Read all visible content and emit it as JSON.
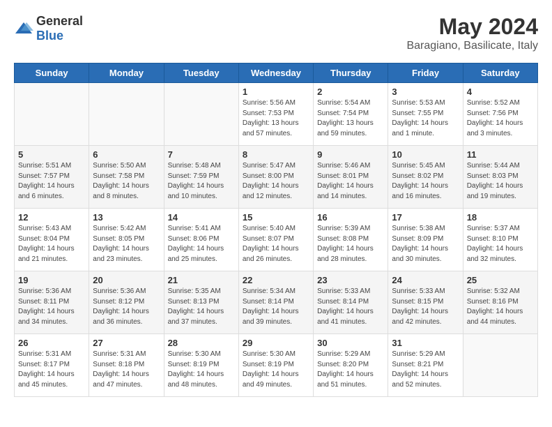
{
  "logo": {
    "general": "General",
    "blue": "Blue"
  },
  "header": {
    "month_year": "May 2024",
    "location": "Baragiano, Basilicate, Italy"
  },
  "weekdays": [
    "Sunday",
    "Monday",
    "Tuesday",
    "Wednesday",
    "Thursday",
    "Friday",
    "Saturday"
  ],
  "weeks": [
    [
      {
        "day": "",
        "sunrise": "",
        "sunset": "",
        "daylight": ""
      },
      {
        "day": "",
        "sunrise": "",
        "sunset": "",
        "daylight": ""
      },
      {
        "day": "",
        "sunrise": "",
        "sunset": "",
        "daylight": ""
      },
      {
        "day": "1",
        "sunrise": "Sunrise: 5:56 AM",
        "sunset": "Sunset: 7:53 PM",
        "daylight": "Daylight: 13 hours and 57 minutes."
      },
      {
        "day": "2",
        "sunrise": "Sunrise: 5:54 AM",
        "sunset": "Sunset: 7:54 PM",
        "daylight": "Daylight: 13 hours and 59 minutes."
      },
      {
        "day": "3",
        "sunrise": "Sunrise: 5:53 AM",
        "sunset": "Sunset: 7:55 PM",
        "daylight": "Daylight: 14 hours and 1 minute."
      },
      {
        "day": "4",
        "sunrise": "Sunrise: 5:52 AM",
        "sunset": "Sunset: 7:56 PM",
        "daylight": "Daylight: 14 hours and 3 minutes."
      }
    ],
    [
      {
        "day": "5",
        "sunrise": "Sunrise: 5:51 AM",
        "sunset": "Sunset: 7:57 PM",
        "daylight": "Daylight: 14 hours and 6 minutes."
      },
      {
        "day": "6",
        "sunrise": "Sunrise: 5:50 AM",
        "sunset": "Sunset: 7:58 PM",
        "daylight": "Daylight: 14 hours and 8 minutes."
      },
      {
        "day": "7",
        "sunrise": "Sunrise: 5:48 AM",
        "sunset": "Sunset: 7:59 PM",
        "daylight": "Daylight: 14 hours and 10 minutes."
      },
      {
        "day": "8",
        "sunrise": "Sunrise: 5:47 AM",
        "sunset": "Sunset: 8:00 PM",
        "daylight": "Daylight: 14 hours and 12 minutes."
      },
      {
        "day": "9",
        "sunrise": "Sunrise: 5:46 AM",
        "sunset": "Sunset: 8:01 PM",
        "daylight": "Daylight: 14 hours and 14 minutes."
      },
      {
        "day": "10",
        "sunrise": "Sunrise: 5:45 AM",
        "sunset": "Sunset: 8:02 PM",
        "daylight": "Daylight: 14 hours and 16 minutes."
      },
      {
        "day": "11",
        "sunrise": "Sunrise: 5:44 AM",
        "sunset": "Sunset: 8:03 PM",
        "daylight": "Daylight: 14 hours and 19 minutes."
      }
    ],
    [
      {
        "day": "12",
        "sunrise": "Sunrise: 5:43 AM",
        "sunset": "Sunset: 8:04 PM",
        "daylight": "Daylight: 14 hours and 21 minutes."
      },
      {
        "day": "13",
        "sunrise": "Sunrise: 5:42 AM",
        "sunset": "Sunset: 8:05 PM",
        "daylight": "Daylight: 14 hours and 23 minutes."
      },
      {
        "day": "14",
        "sunrise": "Sunrise: 5:41 AM",
        "sunset": "Sunset: 8:06 PM",
        "daylight": "Daylight: 14 hours and 25 minutes."
      },
      {
        "day": "15",
        "sunrise": "Sunrise: 5:40 AM",
        "sunset": "Sunset: 8:07 PM",
        "daylight": "Daylight: 14 hours and 26 minutes."
      },
      {
        "day": "16",
        "sunrise": "Sunrise: 5:39 AM",
        "sunset": "Sunset: 8:08 PM",
        "daylight": "Daylight: 14 hours and 28 minutes."
      },
      {
        "day": "17",
        "sunrise": "Sunrise: 5:38 AM",
        "sunset": "Sunset: 8:09 PM",
        "daylight": "Daylight: 14 hours and 30 minutes."
      },
      {
        "day": "18",
        "sunrise": "Sunrise: 5:37 AM",
        "sunset": "Sunset: 8:10 PM",
        "daylight": "Daylight: 14 hours and 32 minutes."
      }
    ],
    [
      {
        "day": "19",
        "sunrise": "Sunrise: 5:36 AM",
        "sunset": "Sunset: 8:11 PM",
        "daylight": "Daylight: 14 hours and 34 minutes."
      },
      {
        "day": "20",
        "sunrise": "Sunrise: 5:36 AM",
        "sunset": "Sunset: 8:12 PM",
        "daylight": "Daylight: 14 hours and 36 minutes."
      },
      {
        "day": "21",
        "sunrise": "Sunrise: 5:35 AM",
        "sunset": "Sunset: 8:13 PM",
        "daylight": "Daylight: 14 hours and 37 minutes."
      },
      {
        "day": "22",
        "sunrise": "Sunrise: 5:34 AM",
        "sunset": "Sunset: 8:14 PM",
        "daylight": "Daylight: 14 hours and 39 minutes."
      },
      {
        "day": "23",
        "sunrise": "Sunrise: 5:33 AM",
        "sunset": "Sunset: 8:14 PM",
        "daylight": "Daylight: 14 hours and 41 minutes."
      },
      {
        "day": "24",
        "sunrise": "Sunrise: 5:33 AM",
        "sunset": "Sunset: 8:15 PM",
        "daylight": "Daylight: 14 hours and 42 minutes."
      },
      {
        "day": "25",
        "sunrise": "Sunrise: 5:32 AM",
        "sunset": "Sunset: 8:16 PM",
        "daylight": "Daylight: 14 hours and 44 minutes."
      }
    ],
    [
      {
        "day": "26",
        "sunrise": "Sunrise: 5:31 AM",
        "sunset": "Sunset: 8:17 PM",
        "daylight": "Daylight: 14 hours and 45 minutes."
      },
      {
        "day": "27",
        "sunrise": "Sunrise: 5:31 AM",
        "sunset": "Sunset: 8:18 PM",
        "daylight": "Daylight: 14 hours and 47 minutes."
      },
      {
        "day": "28",
        "sunrise": "Sunrise: 5:30 AM",
        "sunset": "Sunset: 8:19 PM",
        "daylight": "Daylight: 14 hours and 48 minutes."
      },
      {
        "day": "29",
        "sunrise": "Sunrise: 5:30 AM",
        "sunset": "Sunset: 8:19 PM",
        "daylight": "Daylight: 14 hours and 49 minutes."
      },
      {
        "day": "30",
        "sunrise": "Sunrise: 5:29 AM",
        "sunset": "Sunset: 8:20 PM",
        "daylight": "Daylight: 14 hours and 51 minutes."
      },
      {
        "day": "31",
        "sunrise": "Sunrise: 5:29 AM",
        "sunset": "Sunset: 8:21 PM",
        "daylight": "Daylight: 14 hours and 52 minutes."
      },
      {
        "day": "",
        "sunrise": "",
        "sunset": "",
        "daylight": ""
      }
    ]
  ]
}
